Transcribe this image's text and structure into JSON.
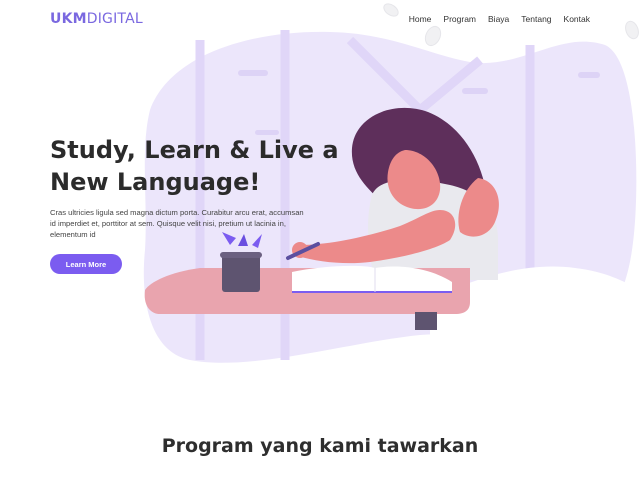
{
  "brand": {
    "bold": "UKM",
    "light": "DIGITAL"
  },
  "nav": {
    "items": [
      "Home",
      "Program",
      "Biaya",
      "Tentang",
      "Kontak"
    ]
  },
  "hero": {
    "title_line1": "Study, Learn & Live a",
    "title_line2": "New Language!",
    "text": "Cras ultricies ligula sed magna dictum porta. Curabitur arcu erat, accumsan id imperdiet et, porttitor at sem. Quisque velit nisi, pretium ut lacinia in, elementum id",
    "button": "Learn More"
  },
  "section": {
    "title": "Program yang kami tawarkan"
  },
  "colors": {
    "accent": "#7b5cf0",
    "blob": "#ece6fb",
    "hair": "#5e2f5b",
    "skin": "#ec8a8a"
  }
}
